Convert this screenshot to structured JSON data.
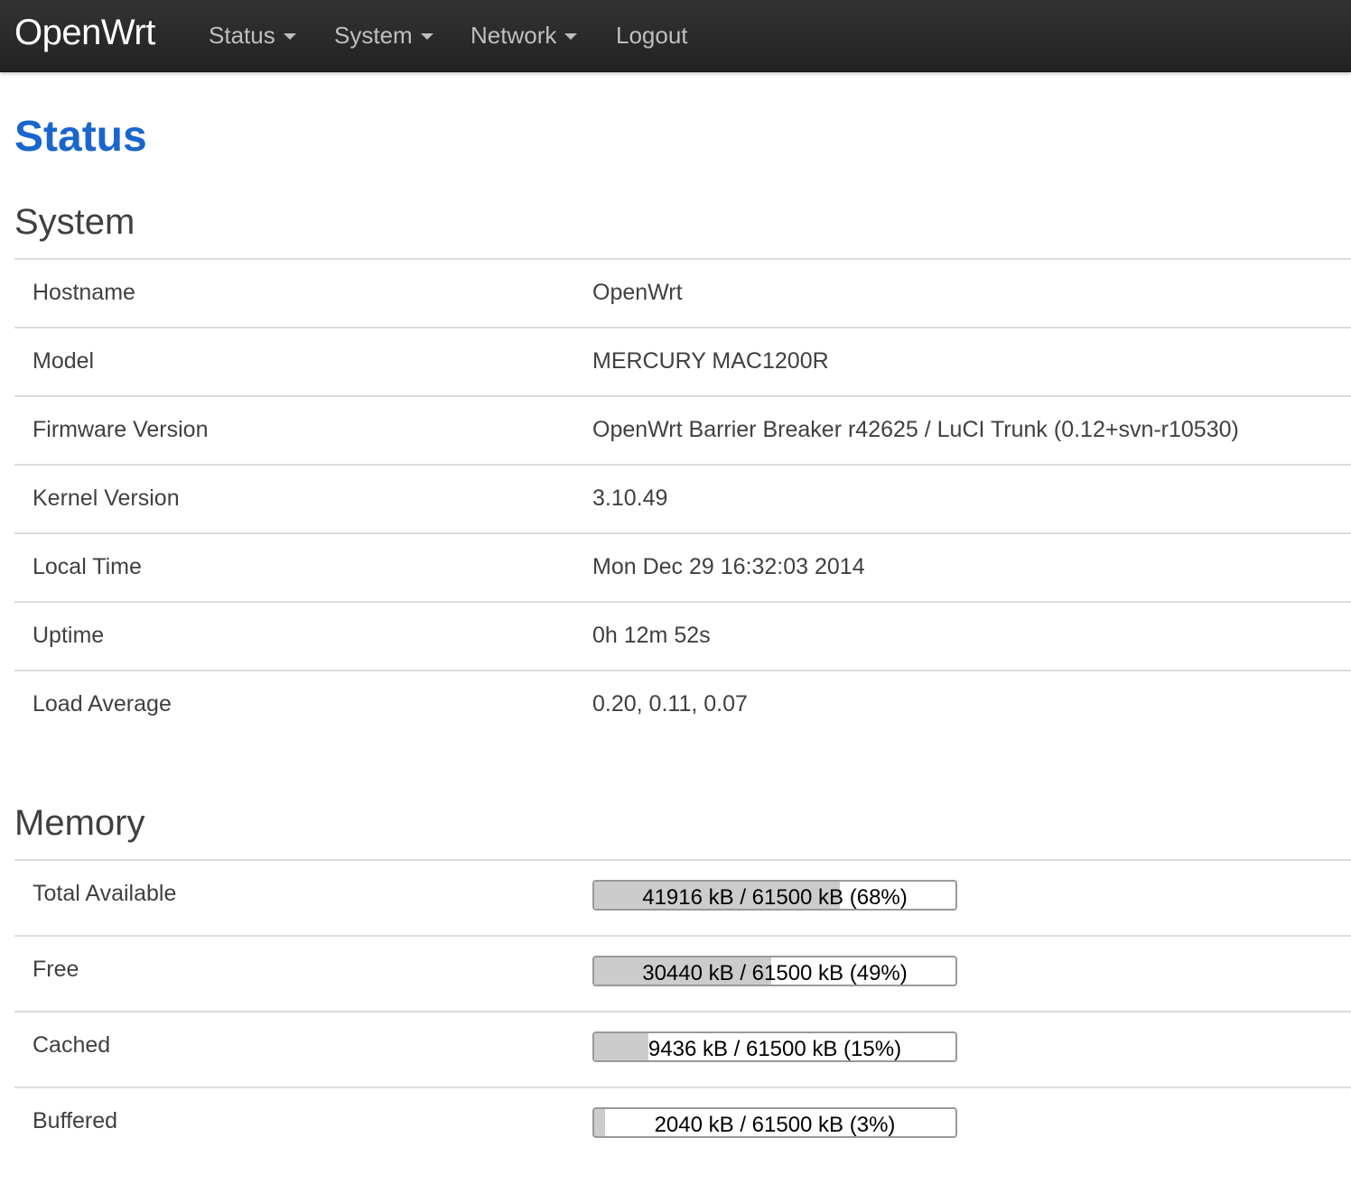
{
  "navbar": {
    "brand": "OpenWrt",
    "menu": [
      {
        "label": "Status",
        "has_dropdown": true
      },
      {
        "label": "System",
        "has_dropdown": true
      },
      {
        "label": "Network",
        "has_dropdown": true
      },
      {
        "label": "Logout",
        "has_dropdown": false
      }
    ]
  },
  "page": {
    "title": "Status"
  },
  "system": {
    "heading": "System",
    "rows": [
      {
        "label": "Hostname",
        "value": "OpenWrt"
      },
      {
        "label": "Model",
        "value": "MERCURY MAC1200R"
      },
      {
        "label": "Firmware Version",
        "value": "OpenWrt Barrier Breaker r42625 / LuCI Trunk (0.12+svn-r10530)"
      },
      {
        "label": "Kernel Version",
        "value": "3.10.49"
      },
      {
        "label": "Local Time",
        "value": "Mon Dec 29 16:32:03 2014"
      },
      {
        "label": "Uptime",
        "value": "0h 12m 52s"
      },
      {
        "label": "Load Average",
        "value": "0.20, 0.11, 0.07"
      }
    ]
  },
  "memory": {
    "heading": "Memory",
    "rows": [
      {
        "label": "Total Available",
        "text": "41916 kB / 61500 kB (68%)",
        "percent": 68
      },
      {
        "label": "Free",
        "text": "30440 kB / 61500 kB (49%)",
        "percent": 49
      },
      {
        "label": "Cached",
        "text": "9436 kB / 61500 kB (15%)",
        "percent": 15
      },
      {
        "label": "Buffered",
        "text": "2040 kB / 61500 kB (3%)",
        "percent": 3
      }
    ]
  },
  "colors": {
    "navbar_bg": "#222222",
    "nav_text": "#bfbfbf",
    "title_blue": "#1a66cc",
    "bar_fill": "#cccccc"
  }
}
